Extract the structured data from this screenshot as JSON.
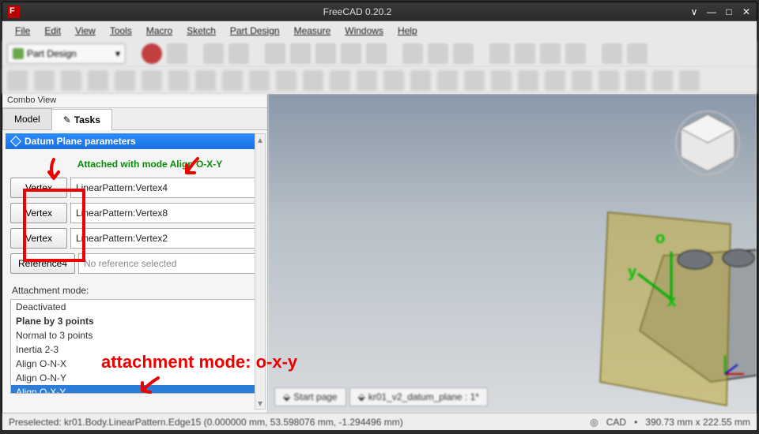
{
  "window": {
    "title": "FreeCAD 0.20.2"
  },
  "menu": [
    "File",
    "Edit",
    "View",
    "Tools",
    "Macro",
    "Sketch",
    "Part Design",
    "Measure",
    "Windows",
    "Help"
  ],
  "workbench": "Part Design",
  "sidebar": {
    "panel_title": "Combo View",
    "tabs": {
      "model": "Model",
      "tasks": "Tasks"
    },
    "task_header": "Datum Plane parameters",
    "attached_text": "Attached with mode Align O-X-Y",
    "refs": [
      {
        "btn": "Vertex",
        "val": "LinearPattern:Vertex4"
      },
      {
        "btn": "Vertex",
        "val": "LinearPattern:Vertex8"
      },
      {
        "btn": "Vertex",
        "val": "LinearPattern:Vertex2"
      },
      {
        "btn": "Reference4",
        "val": "No reference selected"
      }
    ],
    "mode_label": "Attachment mode:",
    "modes": [
      "Deactivated",
      "Plane by 3 points",
      "Normal to 3 points",
      "Inertia 2-3",
      "Align O-N-X",
      "Align O-N-Y",
      "Align O-X-Y"
    ]
  },
  "viewport": {
    "axis_o": "o",
    "axis_x": "x",
    "axis_y": "y",
    "tabs": [
      "Start page",
      "kr01_v2_datum_plane : 1*"
    ]
  },
  "status": {
    "preselect": "Preselected: kr01.Body.LinearPattern.Edge15 (0.000000 mm, 53.598076 mm, -1.294496 mm)",
    "cad_label": "CAD",
    "dims": "390.73 mm x 222.55 mm"
  },
  "annotation": {
    "text": "attachment mode: o-x-y"
  }
}
